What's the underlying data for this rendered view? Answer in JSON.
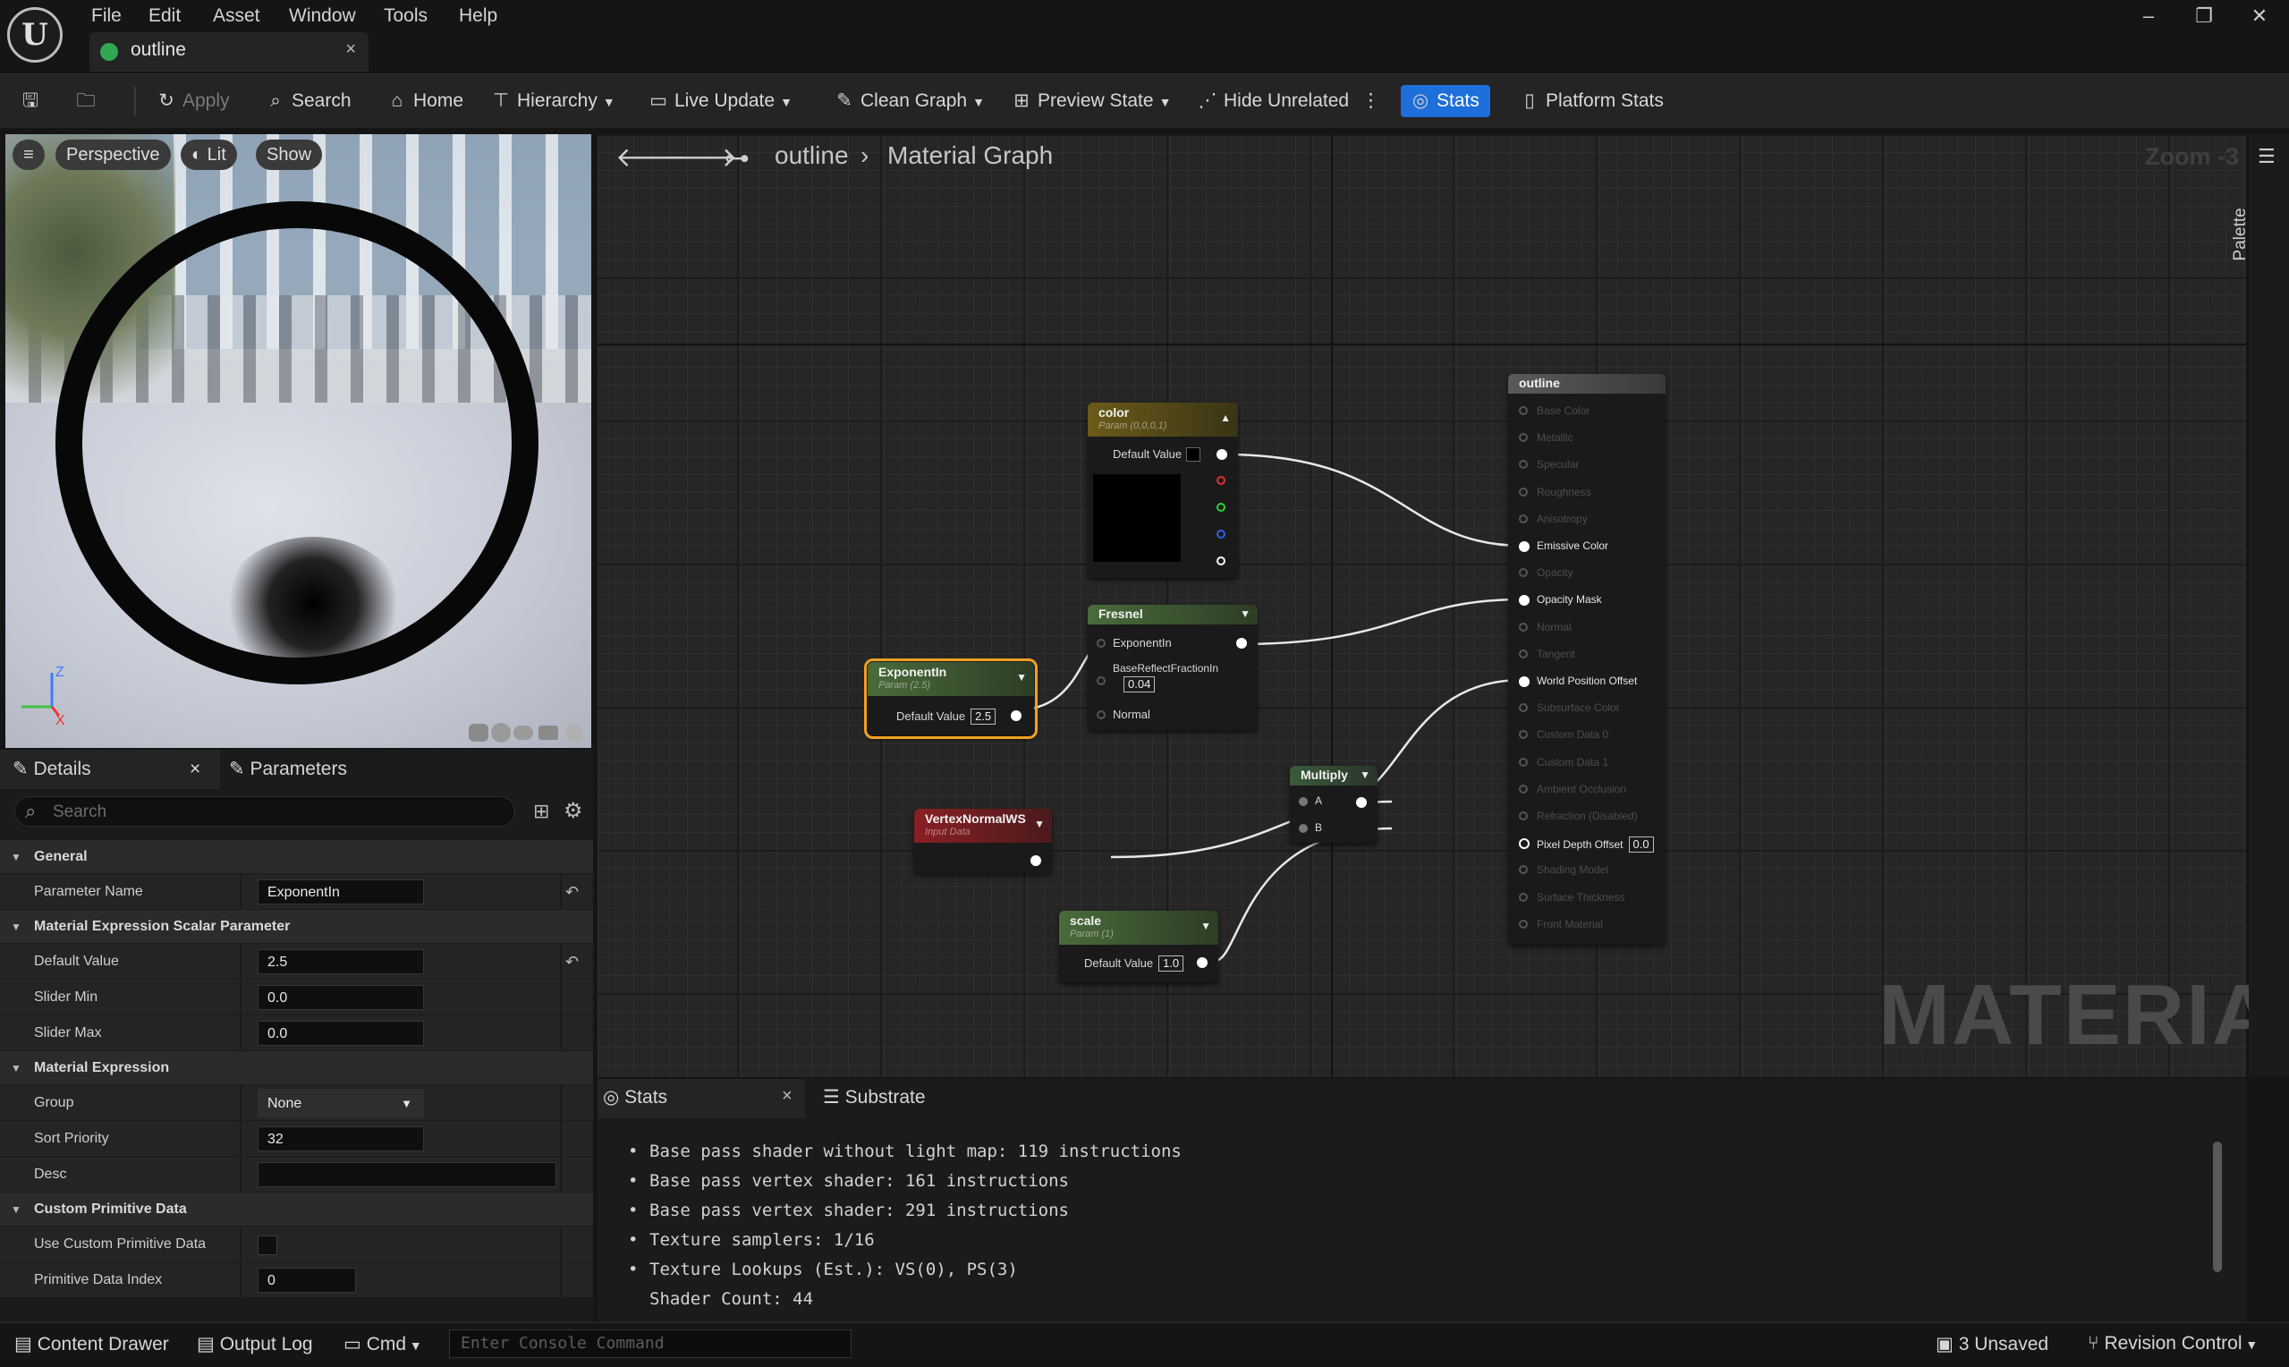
{
  "menu": [
    "File",
    "Edit",
    "Asset",
    "Window",
    "Tools",
    "Help"
  ],
  "document_tab": {
    "label": "outline",
    "close": "×"
  },
  "toolbar": {
    "apply": "Apply",
    "search": "Search",
    "home": "Home",
    "hierarchy": "Hierarchy",
    "live_update": "Live Update",
    "clean_graph": "Clean Graph",
    "preview_state": "Preview State",
    "hide_unrelated": "Hide Unrelated",
    "stats": "Stats",
    "platform_stats": "Platform Stats"
  },
  "viewport": {
    "perspective": "Perspective",
    "lit": "Lit",
    "show": "Show",
    "axis_z": "Z",
    "axis_x": "X"
  },
  "details": {
    "tab_details": "Details",
    "tab_close": "×",
    "tab_parameters": "Parameters",
    "search_placeholder": "Search",
    "sections": {
      "general": "General",
      "scalar": "Material Expression Scalar Parameter",
      "expression": "Material Expression",
      "custom": "Custom Primitive Data"
    },
    "rows": {
      "parameter_name": {
        "label": "Parameter Name",
        "value": "ExponentIn"
      },
      "default_value": {
        "label": "Default Value",
        "value": "2.5"
      },
      "slider_min": {
        "label": "Slider Min",
        "value": "0.0"
      },
      "slider_max": {
        "label": "Slider Max",
        "value": "0.0"
      },
      "group": {
        "label": "Group",
        "value": "None"
      },
      "sort_priority": {
        "label": "Sort Priority",
        "value": "32"
      },
      "desc": {
        "label": "Desc",
        "value": ""
      },
      "use_custom": {
        "label": "Use Custom Primitive Data"
      },
      "primitive_index": {
        "label": "Primitive Data Index",
        "value": "0"
      }
    }
  },
  "graph": {
    "breadcrumb_root": "outline",
    "breadcrumb_sep": "›",
    "breadcrumb_leaf": "Material Graph",
    "zoom": "Zoom -3",
    "watermark": "MATERIAL",
    "palette": "Palette",
    "nodes": {
      "color": {
        "title": "color",
        "subtitle": "Param (0,0,0,1)",
        "default_label": "Default Value"
      },
      "fresnel": {
        "title": "Fresnel",
        "exponent": "ExponentIn",
        "base_reflect": "BaseReflectFractionIn",
        "base_value": "0.04",
        "normal": "Normal"
      },
      "exponent": {
        "title": "ExponentIn",
        "subtitle": "Param (2.5)",
        "default_label": "Default Value",
        "value": "2.5"
      },
      "vertex": {
        "title": "VertexNormalWS",
        "subtitle": "Input Data"
      },
      "multiply": {
        "title": "Multiply",
        "a": "A",
        "b": "B"
      },
      "scale": {
        "title": "scale",
        "subtitle": "Param (1)",
        "default_label": "Default Value",
        "value": "1.0"
      },
      "outline": {
        "title": "outline",
        "pins": [
          "Base Color",
          "Metallic",
          "Specular",
          "Roughness",
          "Anisotropy",
          "Emissive Color",
          "Opacity",
          "Opacity Mask",
          "Normal",
          "Tangent",
          "World Position Offset",
          "Subsurface Color",
          "Custom Data 0",
          "Custom Data 1",
          "Ambient Occlusion",
          "Refraction (Disabled)",
          "Pixel Depth Offset",
          "Shading Model",
          "Surface Thickness",
          "Front Material"
        ],
        "pixel_depth_value": "0.0"
      }
    }
  },
  "stats": {
    "tab_stats": "Stats",
    "tab_close": "×",
    "tab_substrate": "Substrate",
    "lines": [
      "Base pass shader without light map: 119 instructions",
      "Base pass vertex shader: 161 instructions",
      "Base pass vertex shader: 291 instructions",
      "Texture samplers: 1/16",
      "Texture Lookups (Est.): VS(0), PS(3)",
      "Shader Count: 44"
    ]
  },
  "bottom": {
    "content_drawer": "Content Drawer",
    "output_log": "Output Log",
    "cmd": "Cmd",
    "console_placeholder": "Enter Console Command",
    "unsaved": "3 Unsaved",
    "revision": "Revision Control"
  }
}
